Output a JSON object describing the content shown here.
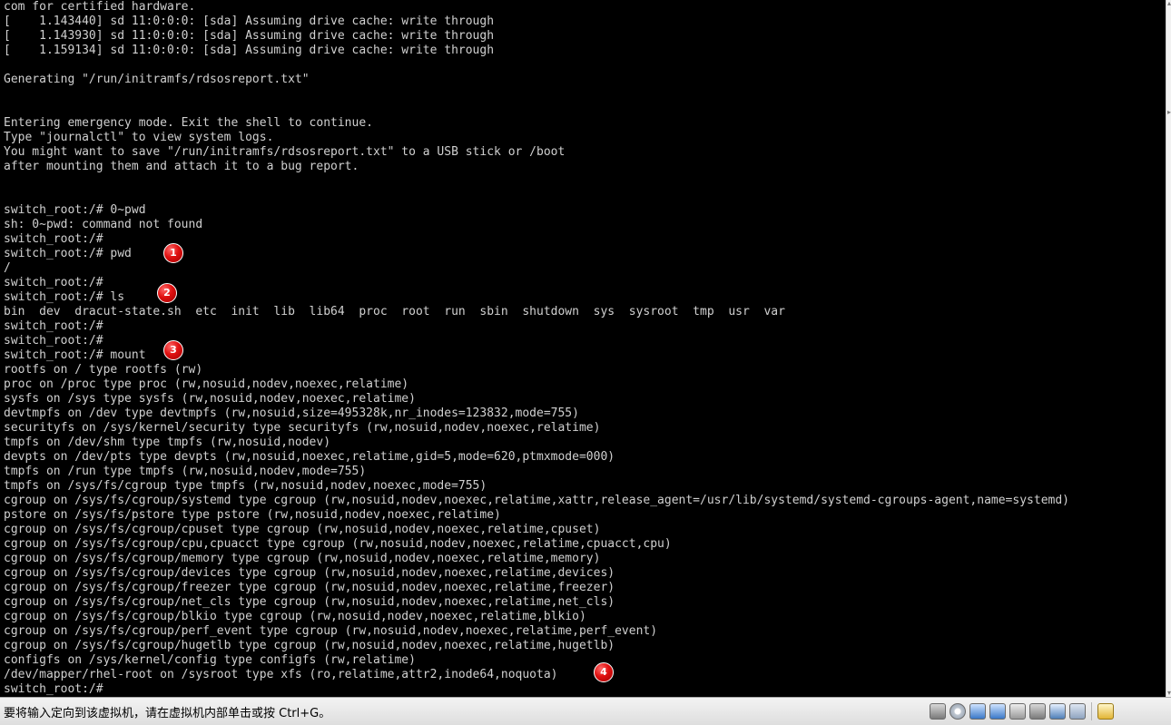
{
  "console": {
    "lines": [
      "com for certified hardware.",
      "[    1.143440] sd 11:0:0:0: [sda] Assuming drive cache: write through",
      "[    1.143930] sd 11:0:0:0: [sda] Assuming drive cache: write through",
      "[    1.159134] sd 11:0:0:0: [sda] Assuming drive cache: write through",
      "",
      "Generating \"/run/initramfs/rdsosreport.txt\"",
      "",
      "",
      "Entering emergency mode. Exit the shell to continue.",
      "Type \"journalctl\" to view system logs.",
      "You might want to save \"/run/initramfs/rdsosreport.txt\" to a USB stick or /boot",
      "after mounting them and attach it to a bug report.",
      "",
      "",
      "switch_root:/# 0~pwd",
      "sh: 0~pwd: command not found",
      "switch_root:/#",
      "switch_root:/# pwd",
      "/",
      "switch_root:/#",
      "switch_root:/# ls",
      "bin  dev  dracut-state.sh  etc  init  lib  lib64  proc  root  run  sbin  shutdown  sys  sysroot  tmp  usr  var",
      "switch_root:/#",
      "switch_root:/#",
      "switch_root:/# mount",
      "rootfs on / type rootfs (rw)",
      "proc on /proc type proc (rw,nosuid,nodev,noexec,relatime)",
      "sysfs on /sys type sysfs (rw,nosuid,nodev,noexec,relatime)",
      "devtmpfs on /dev type devtmpfs (rw,nosuid,size=495328k,nr_inodes=123832,mode=755)",
      "securityfs on /sys/kernel/security type securityfs (rw,nosuid,nodev,noexec,relatime)",
      "tmpfs on /dev/shm type tmpfs (rw,nosuid,nodev)",
      "devpts on /dev/pts type devpts (rw,nosuid,noexec,relatime,gid=5,mode=620,ptmxmode=000)",
      "tmpfs on /run type tmpfs (rw,nosuid,nodev,mode=755)",
      "tmpfs on /sys/fs/cgroup type tmpfs (rw,nosuid,nodev,noexec,mode=755)",
      "cgroup on /sys/fs/cgroup/systemd type cgroup (rw,nosuid,nodev,noexec,relatime,xattr,release_agent=/usr/lib/systemd/systemd-cgroups-agent,name=systemd)",
      "pstore on /sys/fs/pstore type pstore (rw,nosuid,nodev,noexec,relatime)",
      "cgroup on /sys/fs/cgroup/cpuset type cgroup (rw,nosuid,nodev,noexec,relatime,cpuset)",
      "cgroup on /sys/fs/cgroup/cpu,cpuacct type cgroup (rw,nosuid,nodev,noexec,relatime,cpuacct,cpu)",
      "cgroup on /sys/fs/cgroup/memory type cgroup (rw,nosuid,nodev,noexec,relatime,memory)",
      "cgroup on /sys/fs/cgroup/devices type cgroup (rw,nosuid,nodev,noexec,relatime,devices)",
      "cgroup on /sys/fs/cgroup/freezer type cgroup (rw,nosuid,nodev,noexec,relatime,freezer)",
      "cgroup on /sys/fs/cgroup/net_cls type cgroup (rw,nosuid,nodev,noexec,relatime,net_cls)",
      "cgroup on /sys/fs/cgroup/blkio type cgroup (rw,nosuid,nodev,noexec,relatime,blkio)",
      "cgroup on /sys/fs/cgroup/perf_event type cgroup (rw,nosuid,nodev,noexec,relatime,perf_event)",
      "cgroup on /sys/fs/cgroup/hugetlb type cgroup (rw,nosuid,nodev,noexec,relatime,hugetlb)",
      "configfs on /sys/kernel/config type configfs (rw,relatime)",
      "/dev/mapper/rhel-root on /sysroot type xfs (ro,relatime,attr2,inode64,noquota)",
      "switch_root:/#"
    ]
  },
  "markers": [
    "1",
    "2",
    "3",
    "4"
  ],
  "statusbar": {
    "hint": "要将输入定向到该虚拟机，请在虚拟机内部单击或按 Ctrl+G。",
    "tray_icons": [
      "hard-disk-icon",
      "cd-drive-icon",
      "network-adapter-icon",
      "network-adapter-icon",
      "usb-device-icon",
      "printer-icon",
      "sound-card-icon",
      "display-icon",
      "message-icon"
    ]
  },
  "colors": {
    "console_bg": "#000000",
    "console_fg": "#d0d0d0",
    "marker_red": "#e01010"
  }
}
